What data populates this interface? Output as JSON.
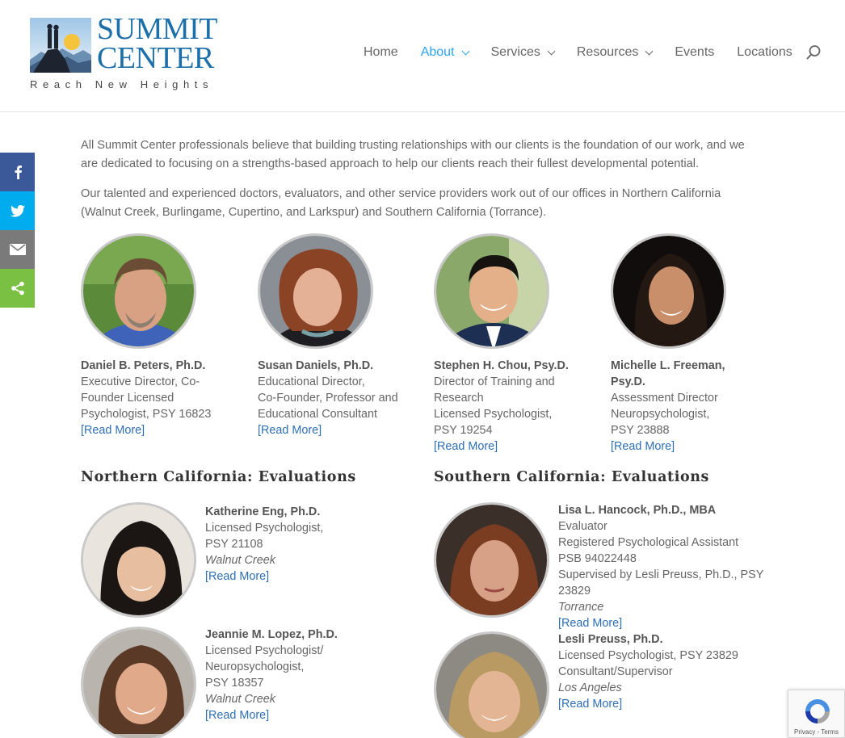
{
  "brand": {
    "name_line1": "SUMMIT",
    "name_line2": "CENTER",
    "tagline": "Reach New Heights"
  },
  "nav": {
    "items": [
      {
        "label": "Home",
        "active": false,
        "dropdown": false
      },
      {
        "label": "About",
        "active": true,
        "dropdown": true
      },
      {
        "label": "Services",
        "active": false,
        "dropdown": true
      },
      {
        "label": "Resources",
        "active": false,
        "dropdown": true
      },
      {
        "label": "Events",
        "active": false,
        "dropdown": false
      },
      {
        "label": "Locations",
        "active": false,
        "dropdown": false
      }
    ],
    "search_icon": "search-icon",
    "active_color": "#2ea3f2"
  },
  "share": {
    "buttons": [
      {
        "icon": "facebook-icon",
        "color": "#3b5998"
      },
      {
        "icon": "twitter-icon",
        "color": "#00aced"
      },
      {
        "icon": "email-icon",
        "color": "#7a7a7a"
      },
      {
        "icon": "share-icon",
        "color": "#7ac143"
      }
    ]
  },
  "intro": {
    "p1": "All Summit Center professionals believe that building trusting relationships with our clients is the foundation of our work, and we are dedicated to focusing on a strengths-based approach to help our clients reach their fullest developmental potential.",
    "p2": "Our talented and experienced doctors, evaluators, and other service providers work out of our offices in Northern California (Walnut Creek, Burlingame, Cupertino, and Larkspur) and Southern California (Torrance)."
  },
  "leadership": [
    {
      "name": "Daniel B. Peters, Ph.D.",
      "details": [
        "Executive Director, Co-",
        "Founder Licensed",
        "Psychologist, PSY 16823"
      ],
      "link": "[Read More]"
    },
    {
      "name": "Susan Daniels, Ph.D.",
      "details": [
        "Educational Director,",
        "Co-Founder, Professor and",
        "Educational Consultant"
      ],
      "link": "[Read More]"
    },
    {
      "name": "Stephen H. Chou, Psy.D.",
      "details": [
        "Director of Training and",
        "Research",
        "Licensed Psychologist,",
        "PSY 19254"
      ],
      "link": "[Read More]"
    },
    {
      "name_lines": [
        "Michelle L. Freeman,",
        "Psy.D."
      ],
      "details": [
        "Assessment Director",
        "Neuropsychologist,",
        "PSY 23888"
      ],
      "link": "[Read More]"
    }
  ],
  "sections": {
    "north_title": "Northern California: Evaluations",
    "south_title": "Southern California: Evaluations"
  },
  "north": [
    {
      "name": "Katherine Eng, Ph.D.",
      "details": [
        "Licensed Psychologist,",
        "PSY 21108"
      ],
      "location": "Walnut Creek",
      "link": "[Read More]"
    },
    {
      "name": "Jeannie M. Lopez, Ph.D.",
      "details": [
        "Licensed Psychologist/",
        "Neuropsychologist,",
        "PSY 18357"
      ],
      "location": "Walnut Creek",
      "link": "[Read More]"
    }
  ],
  "south": [
    {
      "name": "Lisa L. Hancock, Ph.D., MBA",
      "details": [
        "Evaluator",
        "Registered Psychological Assistant",
        "PSB 94022448",
        "Supervised by Lesli Preuss, Ph.D., PSY",
        "23829"
      ],
      "location": "Torrance",
      "link": "[Read More]"
    },
    {
      "name": "Lesli Preuss, Ph.D.",
      "details": [
        "Licensed Psychologist, PSY 23829",
        "Consultant/Supervisor"
      ],
      "location": "Los Angeles",
      "link": "[Read More]"
    }
  ],
  "recaptcha": {
    "text": "Privacy - Terms"
  }
}
